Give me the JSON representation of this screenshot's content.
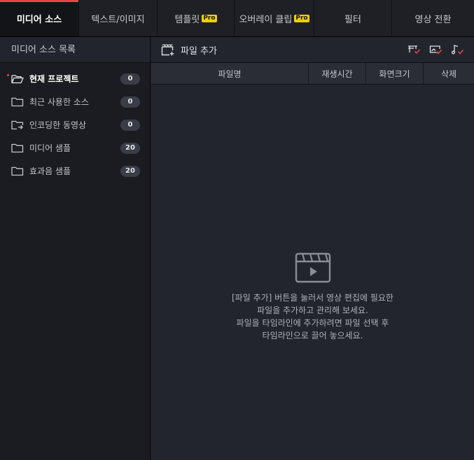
{
  "tabs": [
    {
      "label": "미디어 소스",
      "pro": false,
      "active": true
    },
    {
      "label": "텍스트/이미지",
      "pro": false,
      "active": false
    },
    {
      "label": "템플릿",
      "pro": true,
      "active": false
    },
    {
      "label": "오버레이 클립",
      "pro": true,
      "active": false
    },
    {
      "label": "필터",
      "pro": false,
      "active": false
    },
    {
      "label": "영상 전환",
      "pro": false,
      "active": false
    }
  ],
  "pro_badge": "Pro",
  "sidebar": {
    "title": "미디어 소스 목록",
    "items": [
      {
        "label": "현재 프로젝트",
        "count": "0",
        "icon": "folder-open-icon"
      },
      {
        "label": "최근 사용한 소스",
        "count": "0",
        "icon": "folder-icon"
      },
      {
        "label": "인코딩한 동영상",
        "count": "0",
        "icon": "folder-export-icon"
      },
      {
        "label": "미디어 샘플",
        "count": "20",
        "icon": "folder-icon"
      },
      {
        "label": "효과음 샘플",
        "count": "20",
        "icon": "folder-icon"
      }
    ]
  },
  "main": {
    "add_file_label": "파일 추가",
    "columns": [
      "파일명",
      "재생시간",
      "화면크기",
      "삭제"
    ],
    "empty_lines": [
      "[파일 추가] 버튼을 눌러서 영상 편집에 필요한",
      "파일을 추가하고 관리해 보세요.",
      "파일을 타임라인에 추가하려면 파일 선택 후",
      "타임라인으로 끌어 놓으세요."
    ]
  },
  "colors": {
    "accent": "#e8434f",
    "pro_badge": "#f0d000",
    "background": "#1c1e23"
  }
}
